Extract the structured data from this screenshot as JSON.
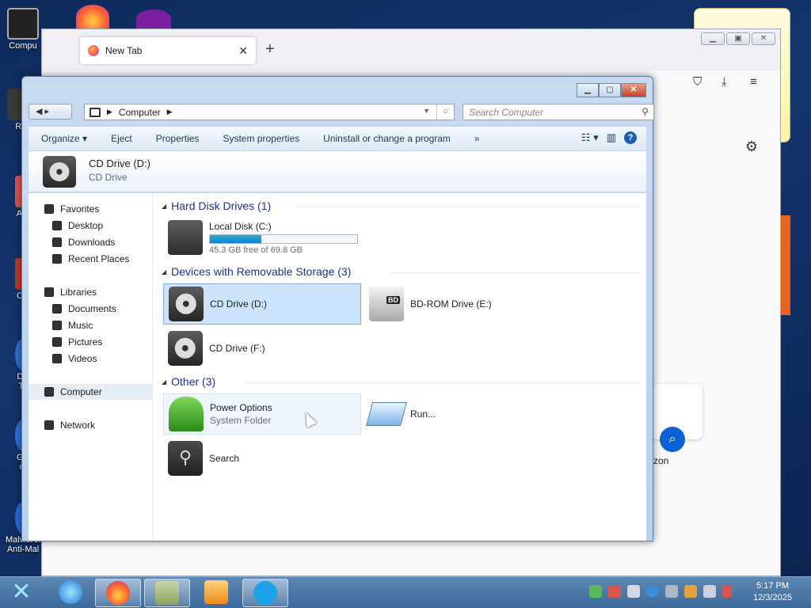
{
  "desktop": {
    "icons": [
      {
        "label": "Compu"
      },
      {
        "label": "Rec"
      },
      {
        "label": "Aut"
      },
      {
        "label": "CC"
      },
      {
        "label": "DA\nTo"
      },
      {
        "label": "GA\ndi"
      },
      {
        "label": "Malwarel\nAnti-Mal"
      }
    ]
  },
  "firefox": {
    "tab_title": "New Tab",
    "tab_close": "✕",
    "new_tab": "+",
    "shortcut_label": "zon"
  },
  "explorer": {
    "address": {
      "location": "Computer"
    },
    "search_placeholder": "Search Computer",
    "commands": [
      "Organize",
      "Eject",
      "Properties",
      "System properties",
      "Uninstall or change a program",
      "»"
    ],
    "details": {
      "title": "CD Drive (D:)",
      "subtitle": "CD Drive"
    },
    "nav": {
      "favorites": "Favorites",
      "desktop": "Desktop",
      "downloads": "Downloads",
      "recent": "Recent Places",
      "libraries": "Libraries",
      "documents": "Documents",
      "music": "Music",
      "pictures": "Pictures",
      "videos": "Videos",
      "computer": "Computer",
      "network": "Network"
    },
    "groups": {
      "hdd": "Hard Disk Drives (1)",
      "removable": "Devices with Removable Storage (3)",
      "other": "Other (3)"
    },
    "items": {
      "local_disk": {
        "name": "Local Disk (C:)",
        "free": "45.3 GB free of 69.8 GB",
        "used_fraction": 0.35
      },
      "cd_d": {
        "name": "CD Drive (D:)"
      },
      "bd_e": {
        "name": "BD-ROM Drive (E:)",
        "badge": "BD"
      },
      "cd_f": {
        "name": "CD Drive (F:)"
      },
      "power": {
        "name": "Power Options",
        "sub": "System Folder"
      },
      "run": {
        "name": "Run..."
      },
      "search": {
        "name": "Search"
      }
    }
  },
  "taskbar": {
    "time": "5:17 PM",
    "date": "12/3/2025"
  }
}
